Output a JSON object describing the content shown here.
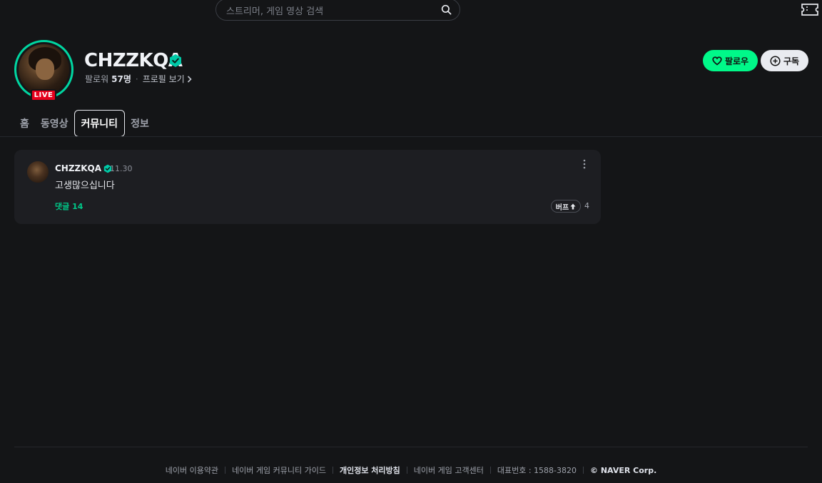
{
  "search": {
    "placeholder": "스트리머, 게임 영상 검색"
  },
  "channel": {
    "name": "CHZZKQA",
    "live_label": "LIVE",
    "followers_label": "팔로워",
    "followers_count": "57명",
    "profile_link": "프로필 보기"
  },
  "actions": {
    "follow_label": "팔로우",
    "subscribe_label": "구독"
  },
  "tabs": [
    {
      "label": "홈"
    },
    {
      "label": "동영상"
    },
    {
      "label": "커뮤니티"
    },
    {
      "label": "정보"
    }
  ],
  "post": {
    "author": "CHZZKQA",
    "date": "11.30",
    "body": "고생많으십니다",
    "comments_label": "댓글 14",
    "buff_label": "버프",
    "buff_count": "4"
  },
  "footer": {
    "links": [
      "네이버 이용약관",
      "네이버 게임 커뮤니티 가이드",
      "개인정보 처리방침",
      "네이버 게임 고객센터",
      "대표번호 : 1588-3820"
    ],
    "copyright": "© NAVER Corp."
  },
  "colors": {
    "accent": "#00f889",
    "live": "#e5001c",
    "background": "#141517"
  }
}
